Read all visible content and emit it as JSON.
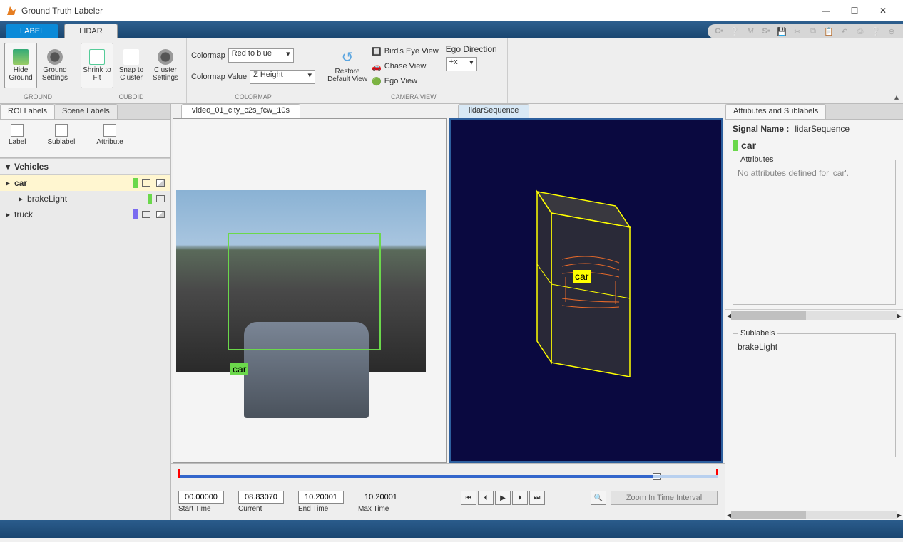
{
  "window": {
    "title": "Ground Truth Labeler"
  },
  "tabs": {
    "label": "LABEL",
    "lidar": "LIDAR"
  },
  "toolstrip": {
    "ground": {
      "hide": "Hide Ground",
      "settings": "Ground Settings",
      "group": "GROUND"
    },
    "cuboid": {
      "shrink": "Shrink to Fit",
      "snap": "Snap to Cluster",
      "cluster": "Cluster Settings",
      "group": "CUBOID"
    },
    "colormap": {
      "label": "Colormap",
      "value_label": "Colormap Value",
      "selected": "Red to blue",
      "value_selected": "Z Height",
      "group": "COLORMAP"
    },
    "restore": "Restore Default View",
    "views": {
      "bev": "Bird's Eye View",
      "chase": "Chase View",
      "ego": "Ego View",
      "group": "CAMERA VIEW",
      "ego_dir": "Ego Direction",
      "ego_dir_val": "+x"
    }
  },
  "leftPanel": {
    "roi_tab": "ROI Labels",
    "scene_tab": "Scene Labels",
    "btn_label": "Label",
    "btn_sublabel": "Sublabel",
    "btn_attribute": "Attribute",
    "group_vehicles": "Vehicles",
    "items": {
      "car": "car",
      "brakeLight": "brakeLight",
      "truck": "truck"
    }
  },
  "viewports": {
    "video_tab": "video_01_city_c2s_fcw_10s",
    "lidar_tab": "lidarSequence",
    "bbox_label": "car",
    "cuboid_label": "car"
  },
  "timeline": {
    "start": "00.00000",
    "start_lbl": "Start Time",
    "current": "08.83070",
    "current_lbl": "Current",
    "end": "10.20001",
    "end_lbl": "End Time",
    "max": "10.20001",
    "max_lbl": "Max Time",
    "zoom": "Zoom In Time Interval"
  },
  "rightPanel": {
    "tab": "Attributes and Sublabels",
    "signal_lbl": "Signal Name :",
    "signal_val": "lidarSequence",
    "label": "car",
    "attributes_legend": "Attributes",
    "attributes_empty": "No attributes defined for 'car'.",
    "sublabels_legend": "Sublabels",
    "sublabel_item": "brakeLight"
  }
}
